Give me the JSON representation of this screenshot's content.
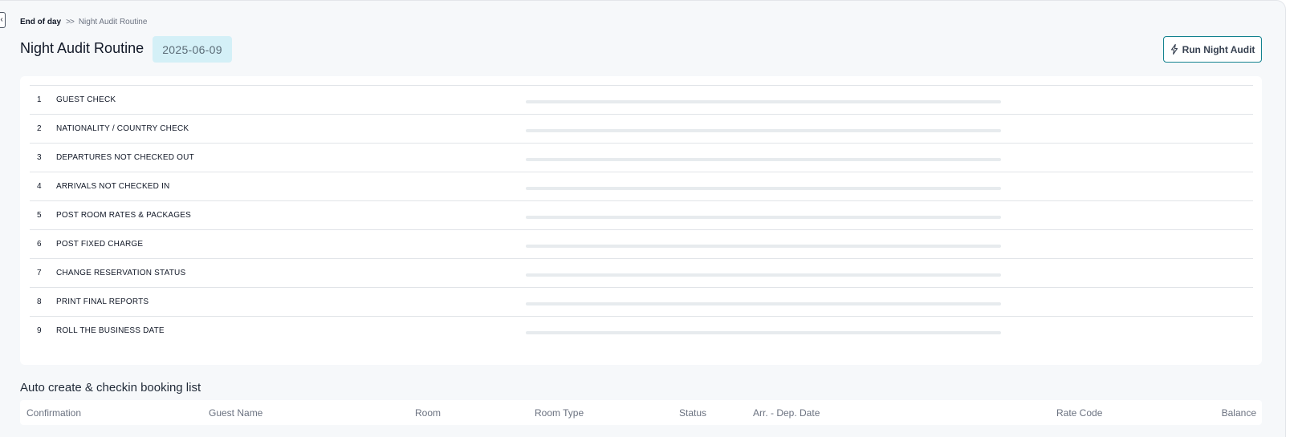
{
  "breadcrumb": {
    "root": "End of day",
    "separator": ">>",
    "current": "Night Audit Routine"
  },
  "header": {
    "title": "Night Audit Routine",
    "business_date": "2025-06-09",
    "run_button_label": "Run Night Audit",
    "run_button_icon": "lightning-icon"
  },
  "steps": [
    {
      "number": "1",
      "label": "GUEST CHECK",
      "progress": 0
    },
    {
      "number": "2",
      "label": "NATIONALITY / COUNTRY CHECK",
      "progress": 0
    },
    {
      "number": "3",
      "label": "DEPARTURES NOT CHECKED OUT",
      "progress": 0
    },
    {
      "number": "4",
      "label": "ARRIVALS NOT CHECKED IN",
      "progress": 0
    },
    {
      "number": "5",
      "label": "POST ROOM RATES & PACKAGES",
      "progress": 0
    },
    {
      "number": "6",
      "label": "POST FIXED CHARGE",
      "progress": 0
    },
    {
      "number": "7",
      "label": "CHANGE RESERVATION STATUS",
      "progress": 0
    },
    {
      "number": "8",
      "label": "PRINT FINAL REPORTS",
      "progress": 0
    },
    {
      "number": "9",
      "label": "ROLL THE BUSINESS DATE",
      "progress": 0
    }
  ],
  "booking_section": {
    "title": "Auto create & checkin booking list",
    "columns": [
      "Confirmation",
      "Guest Name",
      "Room",
      "Room Type",
      "Status",
      "Arr. - Dep. Date",
      "Rate Code",
      "Balance"
    ]
  },
  "colors": {
    "accent": "#13828f",
    "badge_bg": "#d4f0f7",
    "page_bg": "#f6f8fa",
    "track": "#e7ebee"
  }
}
